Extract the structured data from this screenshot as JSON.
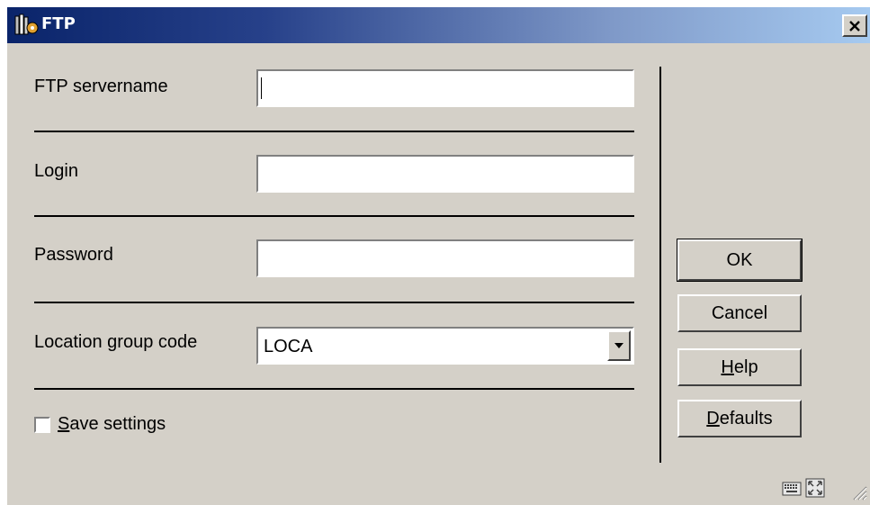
{
  "window": {
    "title": "FTP"
  },
  "form": {
    "ftp_servername": {
      "label": "FTP servername",
      "value": ""
    },
    "login": {
      "label": "Login",
      "value": ""
    },
    "password": {
      "label": "Password",
      "value": ""
    },
    "location_group_code": {
      "label": "Location group code",
      "selected": "LOCA"
    },
    "save_settings": {
      "label_mnemonic": "S",
      "label_rest": "ave settings",
      "checked": false
    }
  },
  "buttons": {
    "ok": "OK",
    "cancel": "Cancel",
    "help_mnemonic": "H",
    "help_rest": "elp",
    "defaults_mnemonic": "D",
    "defaults_rest": "efaults"
  },
  "icons": {
    "app": "bookshelf-icon",
    "close": "close-icon",
    "dropdown": "chevron-down-icon",
    "keyboard": "keyboard-icon",
    "expand": "expand-icon",
    "resize": "resize-grip-icon"
  }
}
